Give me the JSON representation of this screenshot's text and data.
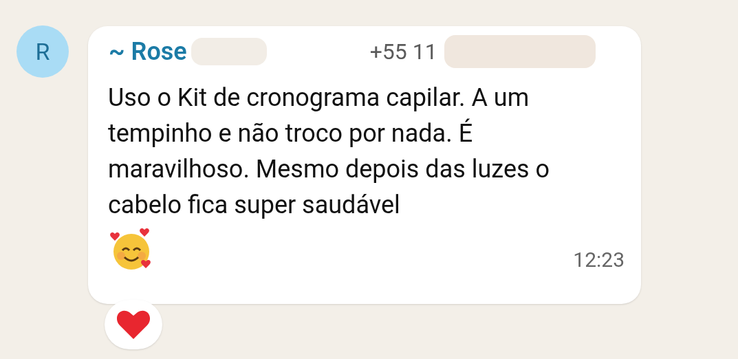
{
  "message": {
    "avatar_letter": "R",
    "sender": "~ Rose",
    "phone": "+55 11",
    "text": "Uso o Kit de cronograma capilar. A um tempinho e não troco por nada. É maravilhoso. Mesmo depois das luzes o cabelo fica super saudável",
    "time": "12:23"
  },
  "reaction": {
    "kind": "heart"
  }
}
